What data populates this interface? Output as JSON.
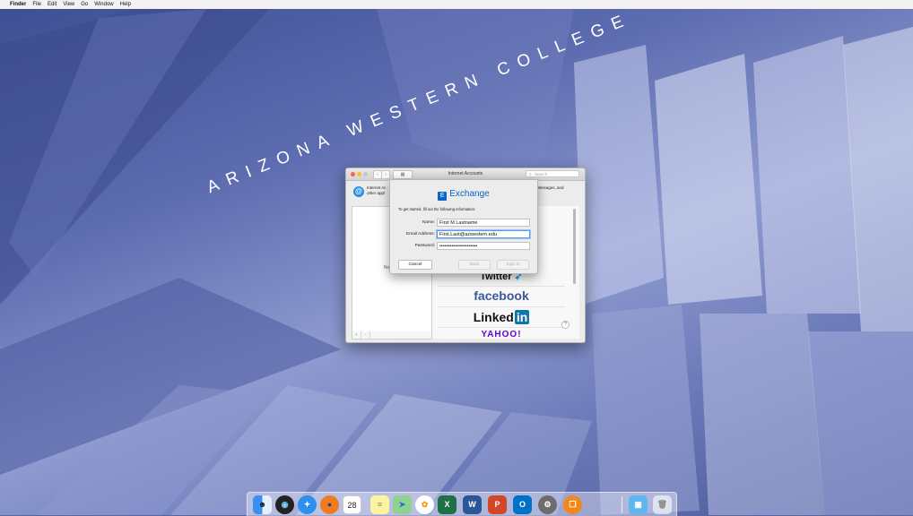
{
  "menubar": {
    "apple": "",
    "items": [
      "Finder",
      "File",
      "Edit",
      "View",
      "Go",
      "Window",
      "Help"
    ]
  },
  "wallpaper": {
    "text": "ARIZONA WESTERN COLLEGE"
  },
  "window": {
    "title": "Internet Accounts",
    "search_placeholder": "Search",
    "info_text_line1": "Internet Ac",
    "info_text_line2": "other appl",
    "info_right": "Messages, and",
    "no_accounts": "No acco",
    "providers": {
      "twitter": "Twitter",
      "facebook": "facebook",
      "linkedin_word": "Linked",
      "linkedin_box": "in",
      "yahoo": "YAHOO!"
    },
    "help": "?",
    "list_add": "+",
    "list_remove": "−"
  },
  "sheet": {
    "title": "Exchange",
    "instructions": "To get started, fill out the following information:",
    "fields": {
      "name_label": "Name:",
      "name_value": "First M Lastname",
      "email_label": "Email Address:",
      "email_value": "First.Last@azwestern.edu",
      "password_label": "Password:",
      "password_value": "••••••••••••••••••••••"
    },
    "buttons": {
      "cancel": "Cancel",
      "back": "Back",
      "signin": "Sign In"
    }
  },
  "dock": {
    "calendar_day": "28",
    "apps": [
      "finder",
      "siri",
      "safari",
      "firefox",
      "calendar",
      "notes",
      "maps",
      "photos",
      "excel",
      "word",
      "powerpoint",
      "outlook",
      "system-preferences",
      "ibooks",
      "downloads",
      "trash"
    ]
  },
  "colors": {
    "accent": "#0a64c6",
    "facebook": "#3b5998",
    "linkedin": "#0e76a8",
    "yahoo": "#5f01d1"
  }
}
